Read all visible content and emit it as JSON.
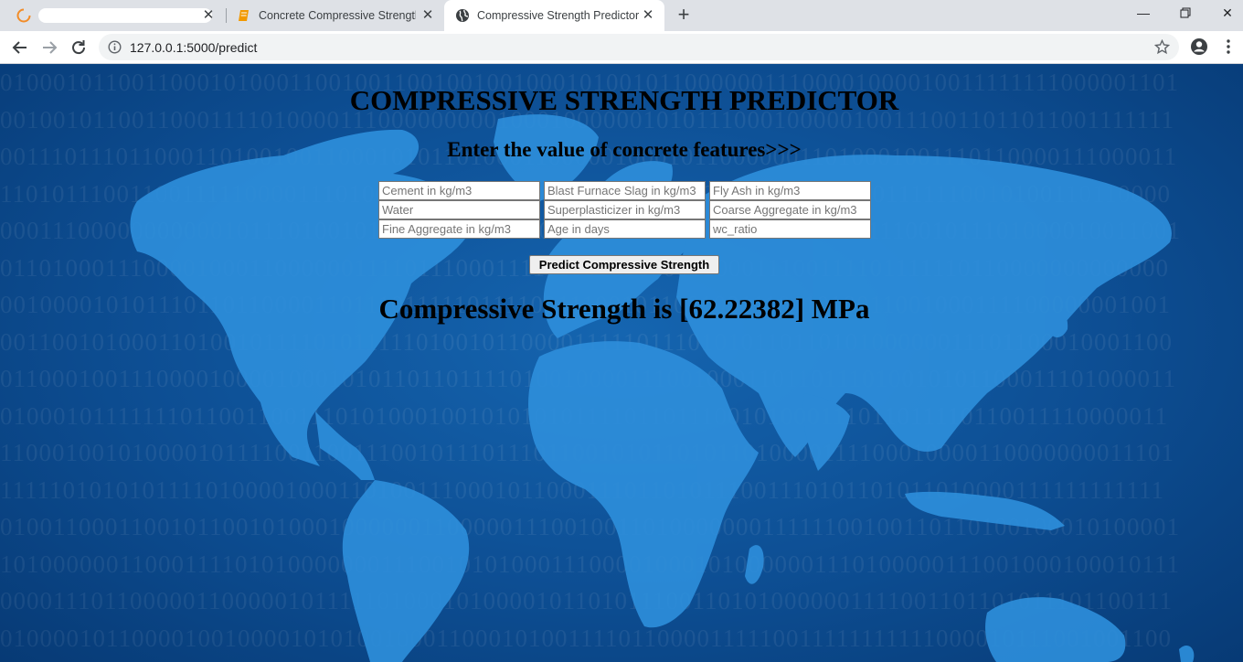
{
  "browser": {
    "tabs": [
      {
        "title": ""
      },
      {
        "title": "Concrete Compressive Strength -"
      },
      {
        "title": "Compressive Strength Predictor"
      }
    ],
    "url": "127.0.0.1:5000/predict"
  },
  "page": {
    "title": "COMPRESSIVE STRENGTH PREDICTOR",
    "subtitle": "Enter the value of concrete features>>>",
    "fields": [
      {
        "placeholder": "Cement in kg/m3"
      },
      {
        "placeholder": "Blast Furnace Slag in kg/m3"
      },
      {
        "placeholder": "Fly Ash in kg/m3"
      },
      {
        "placeholder": "Water"
      },
      {
        "placeholder": "Superplasticizer in kg/m3"
      },
      {
        "placeholder": "Coarse Aggregate in kg/m3"
      },
      {
        "placeholder": "Fine Aggregate in kg/m3"
      },
      {
        "placeholder": "Age in days"
      },
      {
        "placeholder": "wc_ratio"
      }
    ],
    "predict_button": "Predict Compressive Strength",
    "result": "Compressive Strength is [62.22382] MPa"
  },
  "colors": {
    "page_background": "#0d4e93",
    "map_fill": "#2e8fdc",
    "active_tab": "#ffffff",
    "chrome": "#dee1e6"
  }
}
